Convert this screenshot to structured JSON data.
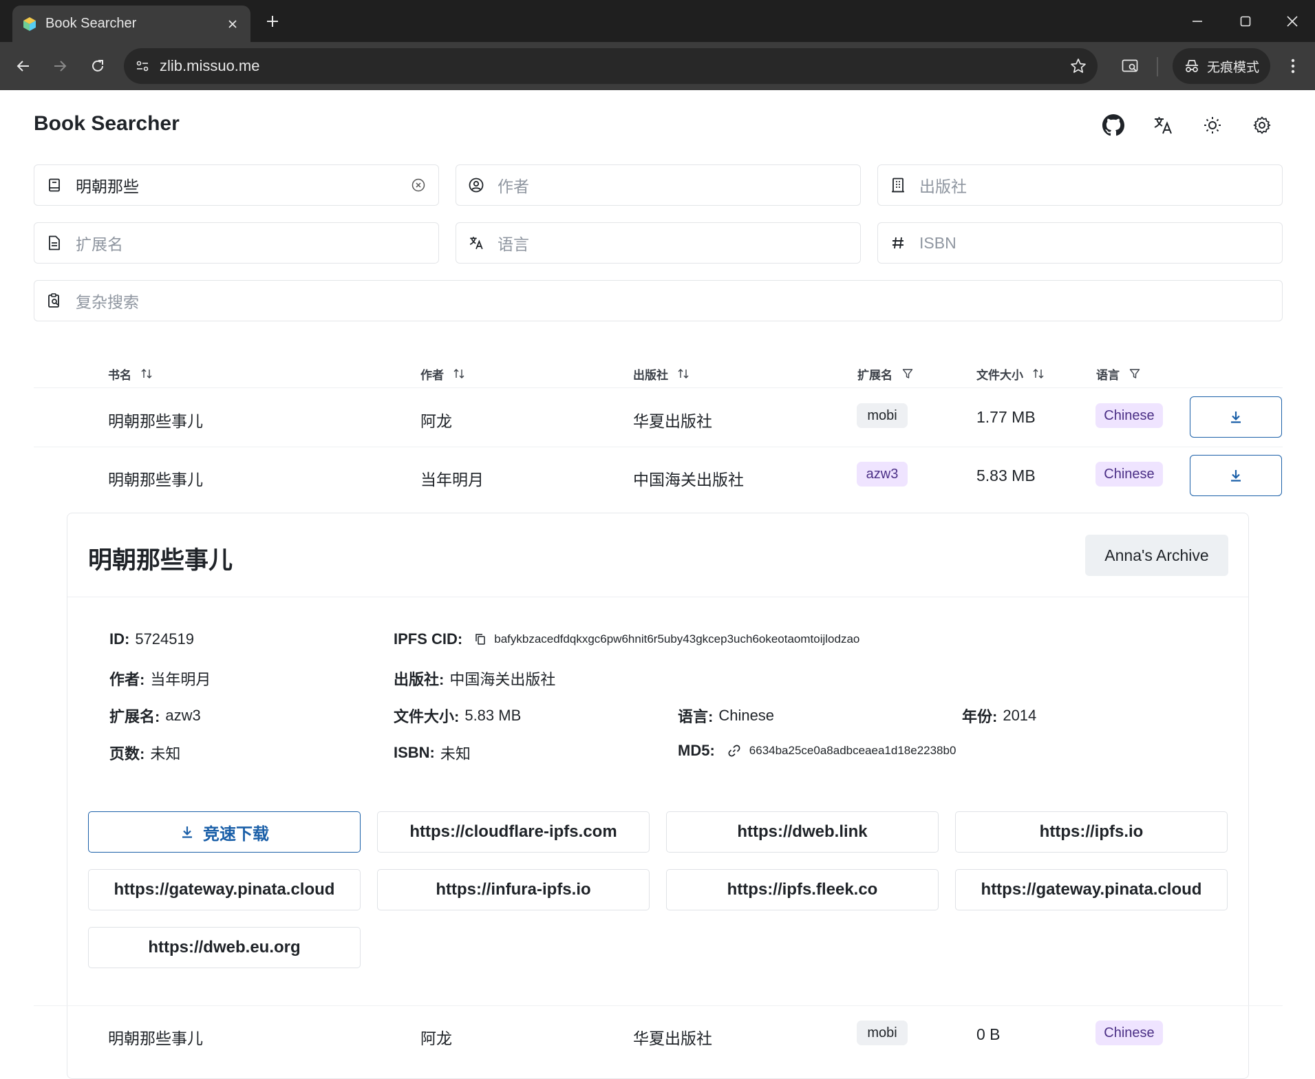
{
  "browser": {
    "tab_title": "Book Searcher",
    "url": "zlib.missuo.me",
    "incognito_label": "无痕模式"
  },
  "app": {
    "title": "Book Searcher"
  },
  "search": {
    "title_value": "明朝那些",
    "author_placeholder": "作者",
    "publisher_placeholder": "出版社",
    "extension_placeholder": "扩展名",
    "language_placeholder": "语言",
    "isbn_placeholder": "ISBN",
    "complex_placeholder": "复杂搜索"
  },
  "table": {
    "headers": [
      "书名",
      "作者",
      "出版社",
      "扩展名",
      "文件大小",
      "语言"
    ],
    "rows": [
      {
        "title": "明朝那些事儿",
        "author": "阿龙",
        "publisher": "华夏出版社",
        "ext": "mobi",
        "size": "1.77 MB",
        "lang": "Chinese"
      },
      {
        "title": "明朝那些事儿",
        "author": "当年明月",
        "publisher": "中国海关出版社",
        "ext": "azw3",
        "size": "5.83 MB",
        "lang": "Chinese"
      },
      {
        "title": "明朝那些事儿",
        "author": "阿龙",
        "publisher": "华夏出版社",
        "ext": "mobi",
        "size": "0 B",
        "lang": "Chinese"
      }
    ]
  },
  "detail": {
    "title": "明朝那些事儿",
    "archive_button": "Anna's Archive",
    "id_label": "ID:",
    "id_value": "5724519",
    "cid_label": "IPFS CID:",
    "cid_value": "bafykbzacedfdqkxgc6pw6hnit6r5uby43gkcep3uch6okeotaomtoijlodzao",
    "author_label": "作者:",
    "author_value": "当年明月",
    "publisher_label": "出版社:",
    "publisher_value": "中国海关出版社",
    "ext_label": "扩展名:",
    "ext_value": "azw3",
    "size_label": "文件大小:",
    "size_value": "5.83 MB",
    "lang_label": "语言:",
    "lang_value": "Chinese",
    "year_label": "年份:",
    "year_value": "2014",
    "pages_label": "页数:",
    "pages_value": "未知",
    "isbn_label": "ISBN:",
    "isbn_value": "未知",
    "md5_label": "MD5:",
    "md5_value": "6634ba25ce0a8adbceaea1d18e2238b0",
    "fast_download": "竞速下载",
    "gateways": [
      "https://cloudflare-ipfs.com",
      "https://dweb.link",
      "https://ipfs.io",
      "https://gateway.pinata.cloud",
      "https://infura-ipfs.io",
      "https://ipfs.fleek.co",
      "https://gateway.pinata.cloud",
      "https://dweb.eu.org"
    ]
  },
  "colors": {
    "accent": "#1a5fa8",
    "tag_purple_bg": "#efe4ff",
    "tag_gray_bg": "#eef0f3"
  }
}
